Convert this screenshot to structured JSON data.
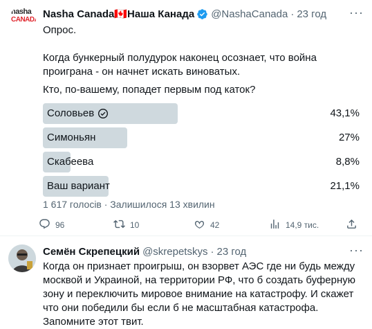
{
  "tweet1": {
    "author_name": "Nasha Canada🇨🇦Наша Канада",
    "handle": "@NashaCanada",
    "separator": "·",
    "time": "23 год",
    "avatar_logo": [
      "nasha",
      "CANADA"
    ],
    "text_line1": "Опрос.",
    "text_line2": "Когда бункерный полудурок наконец осознает, что война проиграна - он начнет искать виноватых.",
    "text_line3": "Кто, по-вашему, попадет первым под каток?",
    "poll": {
      "options": [
        {
          "label": "Соловьев",
          "percent_text": "43,1%",
          "percent": 43.1,
          "winner": true
        },
        {
          "label": "Симоньян",
          "percent_text": "27%",
          "percent": 27,
          "winner": false
        },
        {
          "label": "Скабеева",
          "percent_text": "8,8%",
          "percent": 8.8,
          "winner": false
        },
        {
          "label": "Ваш вариант",
          "percent_text": "21,1%",
          "percent": 21.1,
          "winner": false
        }
      ],
      "meta": "1 617 голосів · Залишилося 13 хвилин"
    },
    "actions": {
      "replies": "96",
      "retweets": "10",
      "likes": "42",
      "views": "14,9 тис."
    }
  },
  "tweet2": {
    "author_name": "Семён Скрепецкий",
    "handle": "@skrepetskys",
    "separator": "·",
    "time": "23 год",
    "text": "Когда он признает проигрыш, он взорвет АЭС где ни будь между москвой и Украиной, на территории РФ, что б создать буферную зону и переключить мировое внимание на катастрофу. И скажет что они победили бы если б не масштабная  катастрофа. Запомните этот твит."
  },
  "colors": {
    "accent": "#1d9bf0",
    "muted": "#536471",
    "poll_bar": "#cfd9de",
    "logo_red": "#e0242b"
  }
}
